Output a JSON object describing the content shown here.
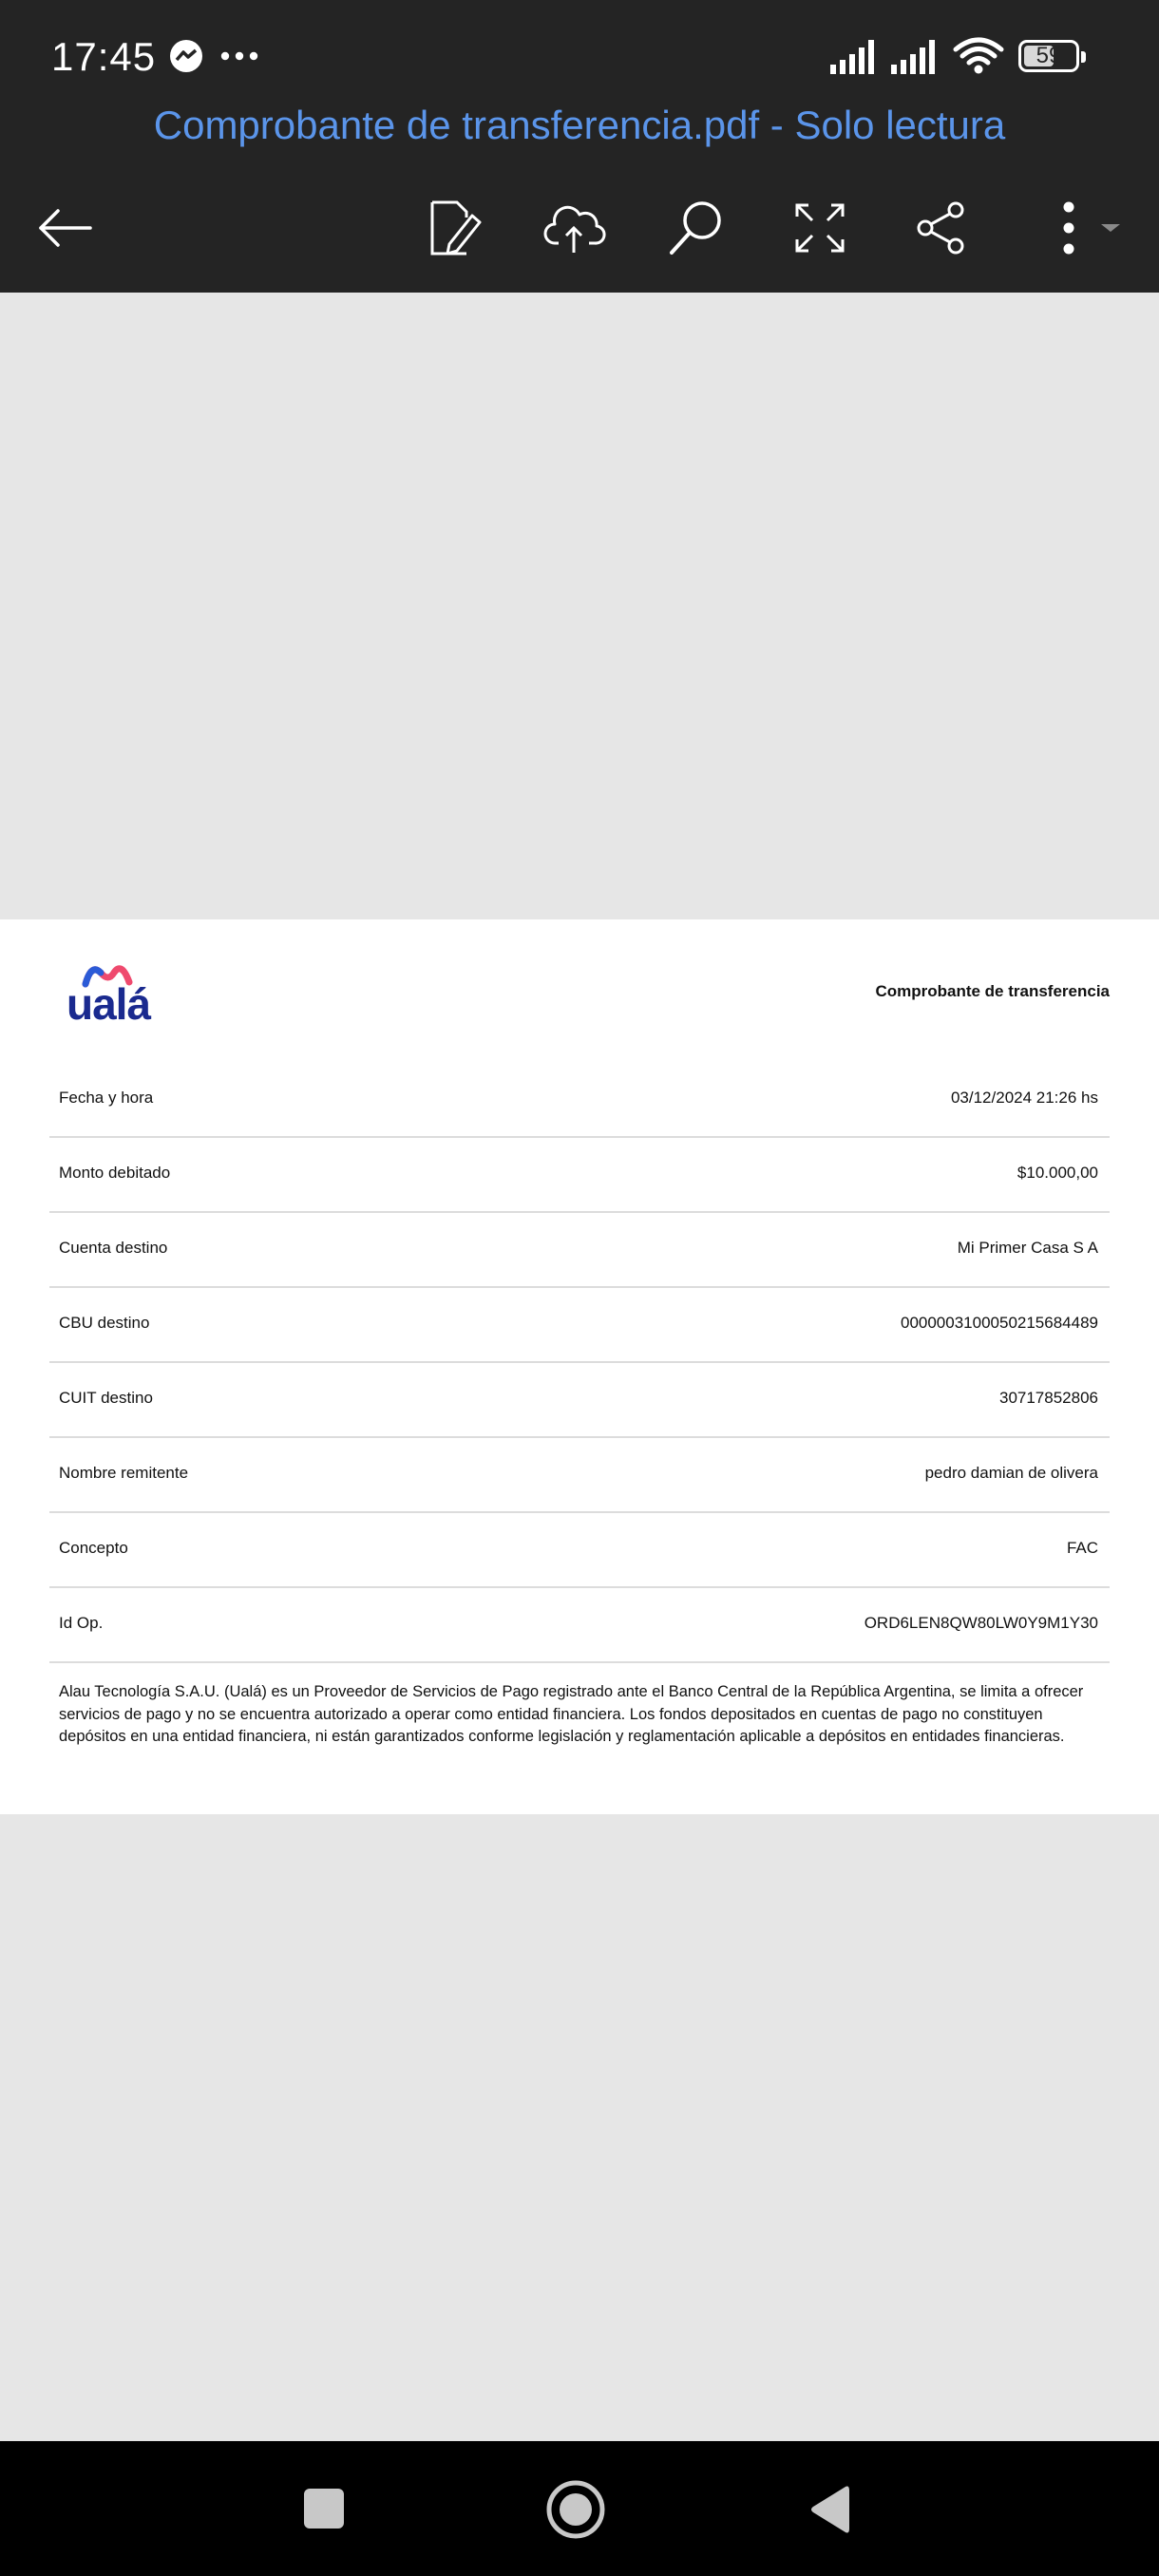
{
  "status_bar": {
    "time": "17:45",
    "battery": "59",
    "battery_level": 0.59,
    "icons": [
      "messenger-icon",
      "more-dots-icon",
      "signal-icon",
      "signal-icon",
      "wifi-icon",
      "battery-icon"
    ]
  },
  "app_bar": {
    "title": "Comprobante de transferencia.pdf - Solo lectura",
    "title_color": "#5b95ea",
    "background": "#242424",
    "actions": [
      "back-arrow-icon",
      "edit-document-icon",
      "cloud-upload-icon",
      "search-icon",
      "fullscreen-icon",
      "share-icon",
      "more-options-icon"
    ]
  },
  "document": {
    "logo_text": "ualá",
    "header_title": "Comprobante de transferencia",
    "rows": [
      {
        "label": "Fecha y hora",
        "value": "03/12/2024 21:26 hs"
      },
      {
        "label": "Monto debitado",
        "value": "$10.000,00"
      },
      {
        "label": "Cuenta destino",
        "value": "Mi Primer Casa S A"
      },
      {
        "label": "CBU destino",
        "value": "0000003100050215684489"
      },
      {
        "label": "CUIT destino",
        "value": "30717852806"
      },
      {
        "label": "Nombre remitente",
        "value": "pedro damian de olivera"
      },
      {
        "label": "Concepto",
        "value": "FAC"
      },
      {
        "label": "Id Op.",
        "value": "ORD6LEN8QW80LW0Y9M1Y30"
      }
    ],
    "disclaimer": "Alau Tecnología S.A.U. (Ualá) es un Proveedor de Servicios de Pago registrado ante el Banco Central de la República Argentina, se limita a ofrecer servicios de pago y no se encuentra autorizado a operar como entidad financiera. Los fondos depositados en cuentas de pago no constituyen depósitos en una entidad financiera, ni están garantizados conforme legislación y reglamentación aplicable a depósitos en entidades financieras."
  },
  "nav_bar": {
    "buttons": [
      "recents-square-icon",
      "home-circle-icon",
      "back-triangle-icon"
    ]
  }
}
